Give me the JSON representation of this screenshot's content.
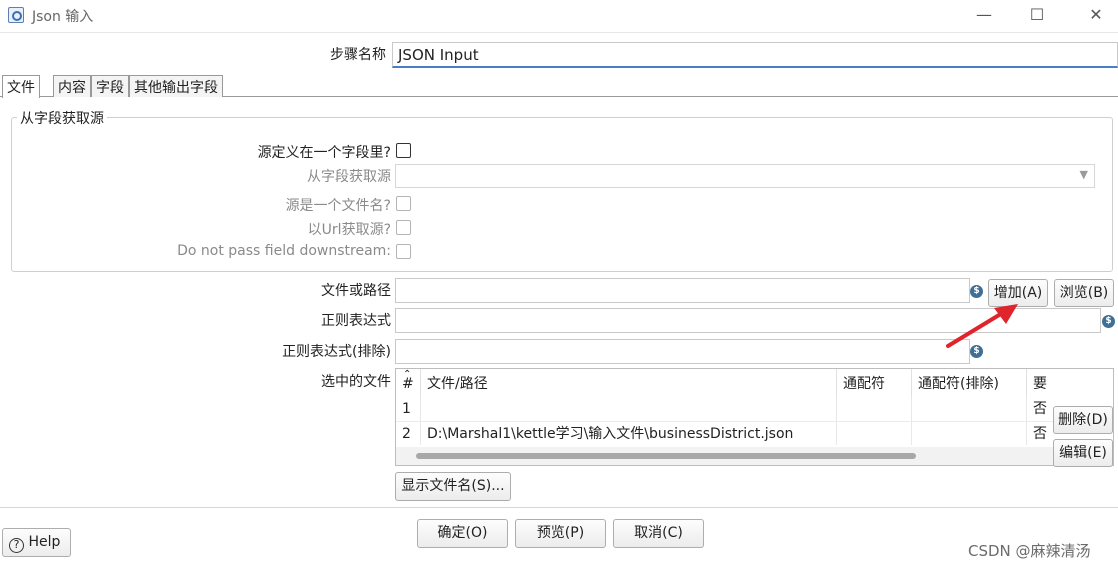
{
  "window": {
    "title": "Json 输入",
    "controls": {
      "minimize": "—",
      "maximize": "☐",
      "close": "✕"
    }
  },
  "step_name": {
    "label": "步骤名称",
    "value": "JSON Input"
  },
  "tabs": [
    {
      "label": "文件",
      "active": true
    },
    {
      "label": "内容",
      "active": false
    },
    {
      "label": "字段",
      "active": false
    },
    {
      "label": "其他输出字段",
      "active": false
    }
  ],
  "source_group": {
    "title": "从字段获取源",
    "source_in_field_label": "源定义在一个字段里?",
    "source_field_label": "从字段获取源",
    "source_is_filename_label": "源是一个文件名?",
    "source_is_url_label": "以Url获取源?",
    "do_not_pass_label": "Do not pass field downstream:"
  },
  "file_section": {
    "file_path_label": "文件或路径",
    "file_path_value": "",
    "regex_label": "正则表达式",
    "regex_value": "",
    "regex_exclude_label": "正则表达式(排除)",
    "regex_exclude_value": "",
    "selected_files_label": "选中的文件",
    "add_button": "增加(A)",
    "browse_button": "浏览(B)",
    "delete_button": "删除(D)",
    "edit_button": "编辑(E)",
    "show_filenames_button": "显示文件名(S)..."
  },
  "files_table": {
    "columns": [
      "#",
      "文件/路径",
      "通配符",
      "通配符(排除)",
      "要"
    ],
    "rows": [
      {
        "num": "1",
        "path": "",
        "wildcard": "",
        "exclude": "",
        "required": "否"
      },
      {
        "num": "2",
        "path": "D:\\Marshal1\\kettle学习\\输入文件\\businessDistrict.json",
        "wildcard": "",
        "exclude": "",
        "required": "否"
      }
    ]
  },
  "footer": {
    "help_button": "Help",
    "ok_button": "确定(O)",
    "preview_button": "预览(P)",
    "cancel_button": "取消(C)"
  },
  "watermark": "CSDN @麻辣清汤",
  "colors": {
    "annotation_arrow": "#e0242b",
    "variable_icon": "#3f6f96"
  },
  "icons": {
    "variable": "$",
    "sort": "⌃",
    "help": "?",
    "dropdown": "▼"
  }
}
